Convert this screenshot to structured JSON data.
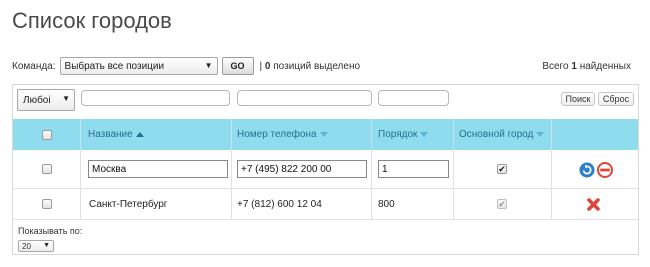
{
  "page": {
    "title": "Список городов"
  },
  "toolbar": {
    "command_label": "Команда:",
    "command_value": "Выбрать все позиции",
    "go_label": "GO",
    "selected_count": "0",
    "selected_suffix": "позиций выделено",
    "total_prefix": "Всего",
    "total_count": "1",
    "total_suffix": "найденных"
  },
  "filter": {
    "status_value": "Любоі",
    "search_label": "Поиск",
    "reset_label": "Сброс"
  },
  "table": {
    "columns": [
      {
        "label": "Название",
        "sort": "asc"
      },
      {
        "label": "Номер телефона",
        "sort": "none"
      },
      {
        "label": "Порядок",
        "sort": "none"
      },
      {
        "label": "Основной город",
        "sort": "none"
      }
    ],
    "rows": [
      {
        "name": "Москва",
        "phone": "+7 (495) 822 200 00",
        "order": "1",
        "main_city": true,
        "editing": true
      },
      {
        "name": "Санкт-Петербург",
        "phone": "+7 (812) 600 12 04",
        "order": "800",
        "main_city": true,
        "editing": false
      }
    ]
  },
  "pager": {
    "label": "Показывать по:",
    "value": "20"
  },
  "icons": {
    "save": "refresh-arrow-icon",
    "cancel": "no-entry-icon",
    "delete": "delete-x-icon"
  },
  "colors": {
    "header_bg": "#8fdcef",
    "header_text": "#2a6e8f",
    "save_icon": "#2b7fd0",
    "cancel_icon": "#e0443a"
  }
}
